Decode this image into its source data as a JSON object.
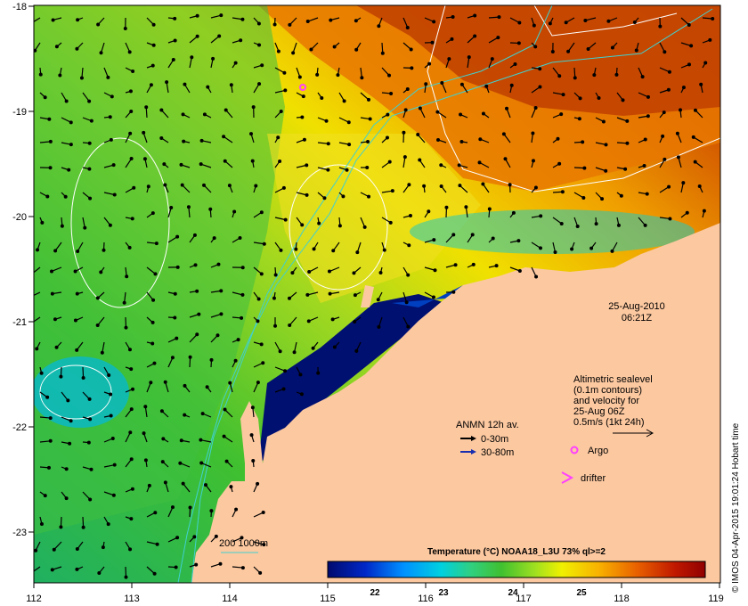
{
  "map": {
    "date": "25-Aug-2010",
    "time": "06:21Z",
    "credit": "© IMOS 04-Apr-2015 19:01:24 Hobart time",
    "x_ticks": [
      "112",
      "113",
      "114",
      "115",
      "116",
      "117",
      "118",
      "119"
    ],
    "y_ticks": [
      "-18",
      "-19",
      "-20",
      "-21",
      "-22",
      "-23"
    ],
    "legend_altimetry": [
      "Altimetric sealevel",
      "(0.1m contours)",
      "and velocity for",
      "25-Aug 06Z",
      "0.5m/s (1kt 24h)"
    ],
    "legend_anmn_title": "ANMN 12h av.",
    "legend_anmn_items": [
      {
        "label": "0-30m",
        "color": "#000000"
      },
      {
        "label": "30-80m",
        "color": "#1a2fb0"
      }
    ],
    "legend_argo": "Argo",
    "legend_drifter": "drifter",
    "isobath_label": "200  1000m",
    "colorbar": {
      "title": "Temperature (°C) NOAA18_L3U 73% ql>=2",
      "ticks": [
        "22",
        "23",
        "24",
        "25"
      ],
      "range": [
        21.0,
        25.9
      ],
      "colors": [
        "#000a6e",
        "#0028c8",
        "#0090ff",
        "#00d0e0",
        "#30d080",
        "#40c030",
        "#a0e020",
        "#f0f000",
        "#f8b000",
        "#e86000",
        "#c01800",
        "#900000"
      ]
    },
    "colors": {
      "land": "#fcc8a0",
      "warm": "#c84000",
      "cold": "#001070"
    }
  }
}
